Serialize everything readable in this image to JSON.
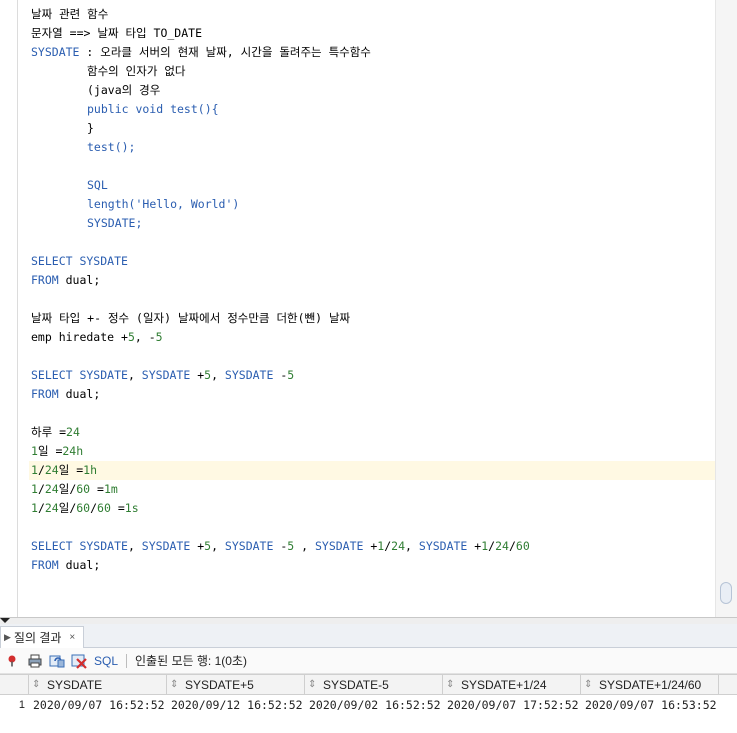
{
  "editor": {
    "lines": [
      {
        "segs": [
          {
            "t": "날짜 관련 함수"
          }
        ]
      },
      {
        "segs": [
          {
            "t": "문자열 ==> 날짜 타입 TO_DATE"
          }
        ]
      },
      {
        "segs": [
          {
            "t": "SYSDATE",
            "c": "kw"
          },
          {
            "t": " : 오라클 서버의 현재 날짜, 시간을 돌려주는 특수함수"
          }
        ]
      },
      {
        "indent": true,
        "segs": [
          {
            "t": "함수의 인자가 없다"
          }
        ]
      },
      {
        "indent": true,
        "segs": [
          {
            "t": "(java의 경우"
          }
        ]
      },
      {
        "indent": true,
        "segs": [
          {
            "t": "public void test(){",
            "c": "kw"
          }
        ]
      },
      {
        "indent": true,
        "segs": [
          {
            "t": "}"
          }
        ]
      },
      {
        "indent": true,
        "segs": [
          {
            "t": "test();",
            "c": "kw"
          }
        ]
      },
      {
        "segs": []
      },
      {
        "indent": true,
        "segs": [
          {
            "t": "SQL",
            "c": "kw"
          }
        ]
      },
      {
        "indent": true,
        "segs": [
          {
            "t": "length(",
            "c": "kw"
          },
          {
            "t": "'Hello, World'",
            "c": "str"
          },
          {
            "t": ")",
            "c": "kw"
          }
        ]
      },
      {
        "indent": true,
        "segs": [
          {
            "t": "SYSDATE;",
            "c": "kw"
          }
        ]
      },
      {
        "segs": []
      },
      {
        "segs": [
          {
            "t": "SELECT SYSDATE",
            "c": "kw"
          }
        ]
      },
      {
        "segs": [
          {
            "t": "FROM",
            "c": "kw"
          },
          {
            "t": " dual;"
          }
        ]
      },
      {
        "segs": []
      },
      {
        "segs": [
          {
            "t": "날짜 타입 +- 정수 (일자) 날짜에서 정수만큼 더한(뺀) 날짜"
          }
        ]
      },
      {
        "segs": [
          {
            "t": "emp hiredate +"
          },
          {
            "t": "5",
            "c": "num"
          },
          {
            "t": ", -"
          },
          {
            "t": "5",
            "c": "num"
          }
        ]
      },
      {
        "segs": []
      },
      {
        "segs": [
          {
            "t": "SELECT SYSDATE",
            "c": "kw"
          },
          {
            "t": ", "
          },
          {
            "t": "SYSDATE",
            "c": "kw"
          },
          {
            "t": " +"
          },
          {
            "t": "5",
            "c": "num"
          },
          {
            "t": ", "
          },
          {
            "t": "SYSDATE",
            "c": "kw"
          },
          {
            "t": " -"
          },
          {
            "t": "5",
            "c": "num"
          }
        ]
      },
      {
        "segs": [
          {
            "t": "FROM",
            "c": "kw"
          },
          {
            "t": " dual;"
          }
        ]
      },
      {
        "segs": []
      },
      {
        "segs": [
          {
            "t": "하루 ="
          },
          {
            "t": "24",
            "c": "num"
          }
        ]
      },
      {
        "segs": [
          {
            "t": "1",
            "c": "num"
          },
          {
            "t": "일 ="
          },
          {
            "t": "24h",
            "c": "num"
          }
        ]
      },
      {
        "highlight": true,
        "segs": [
          {
            "t": "1",
            "c": "num"
          },
          {
            "t": "/"
          },
          {
            "t": "24",
            "c": "num"
          },
          {
            "t": "일 ="
          },
          {
            "t": "1h",
            "c": "num"
          }
        ]
      },
      {
        "segs": [
          {
            "t": "1",
            "c": "num"
          },
          {
            "t": "/"
          },
          {
            "t": "24",
            "c": "num"
          },
          {
            "t": "일/"
          },
          {
            "t": "60",
            "c": "num"
          },
          {
            "t": " ="
          },
          {
            "t": "1m",
            "c": "num"
          }
        ]
      },
      {
        "segs": [
          {
            "t": "1",
            "c": "num"
          },
          {
            "t": "/"
          },
          {
            "t": "24",
            "c": "num"
          },
          {
            "t": "일/"
          },
          {
            "t": "60",
            "c": "num"
          },
          {
            "t": "/"
          },
          {
            "t": "60",
            "c": "num"
          },
          {
            "t": " ="
          },
          {
            "t": "1s",
            "c": "num"
          }
        ]
      },
      {
        "segs": []
      },
      {
        "segs": [
          {
            "t": "SELECT SYSDATE",
            "c": "kw"
          },
          {
            "t": ", "
          },
          {
            "t": "SYSDATE",
            "c": "kw"
          },
          {
            "t": " +"
          },
          {
            "t": "5",
            "c": "num"
          },
          {
            "t": ", "
          },
          {
            "t": "SYSDATE",
            "c": "kw"
          },
          {
            "t": " -"
          },
          {
            "t": "5",
            "c": "num"
          },
          {
            "t": " , "
          },
          {
            "t": "SYSDATE",
            "c": "kw"
          },
          {
            "t": " +"
          },
          {
            "t": "1",
            "c": "num"
          },
          {
            "t": "/"
          },
          {
            "t": "24",
            "c": "num"
          },
          {
            "t": ", "
          },
          {
            "t": "SYSDATE",
            "c": "kw"
          },
          {
            "t": " +"
          },
          {
            "t": "1",
            "c": "num"
          },
          {
            "t": "/"
          },
          {
            "t": "24",
            "c": "num"
          },
          {
            "t": "/"
          },
          {
            "t": "60",
            "c": "num"
          }
        ]
      },
      {
        "segs": [
          {
            "t": "FROM",
            "c": "kw"
          },
          {
            "t": " dual;"
          }
        ]
      }
    ]
  },
  "results": {
    "tab_label": "질의 결과",
    "tab_close": "×",
    "toolbar": {
      "sql_label": "SQL",
      "status": "인출된 모든 행: 1(0초)"
    },
    "columns": [
      "SYSDATE",
      "SYSDATE+5",
      "SYSDATE-5",
      "SYSDATE+1/24",
      "SYSDATE+1/24/60"
    ],
    "rows": [
      {
        "num": "1",
        "cells": [
          "2020/09/07 16:52:52",
          "2020/09/12 16:52:52",
          "2020/09/02 16:52:52",
          "2020/09/07 17:52:52",
          "2020/09/07 16:53:52"
        ]
      }
    ]
  },
  "colors": {
    "keyword": "#2a5db0",
    "number": "#2f7d32",
    "highlight_line": "#fff9e3"
  }
}
